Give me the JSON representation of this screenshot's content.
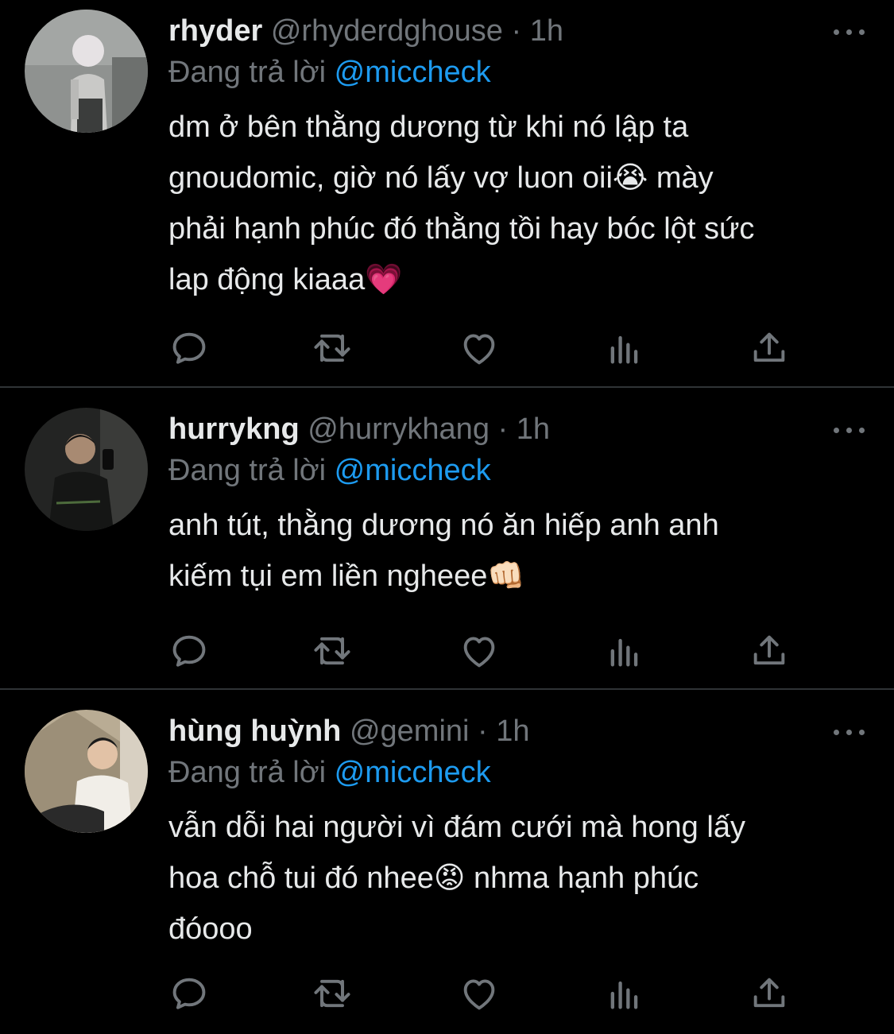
{
  "tweets": [
    {
      "name": "rhyder",
      "handle": "@rhyderdghouse",
      "separator": "·",
      "time": "1h",
      "reply_prefix": "Đang trả lời",
      "reply_to": "@miccheck",
      "lines": [
        "dm ở bên thằng dương từ khi nó lập ta",
        "gnoudomic, giờ nó lấy vợ luon oii😭  mày",
        "phải hạnh phúc đó thằng tồi hay bóc lột sức",
        "lap động kiaaa💗"
      ]
    },
    {
      "name": "hurrykng",
      "handle": "@hurrykhang",
      "separator": "·",
      "time": "1h",
      "reply_prefix": "Đang trả lời",
      "reply_to": "@miccheck",
      "lines": [
        "anh tút, thằng dương nó ăn hiếp anh anh",
        "kiếm tụi em liền ngheee👊🏻"
      ]
    },
    {
      "name": "hùng huỳnh",
      "handle": "@gemini",
      "separator": "·",
      "time": "1h",
      "reply_prefix": "Đang trả lời",
      "reply_to": "@miccheck",
      "lines": [
        "vẫn dỗi hai người vì đám cưới mà hong lấy",
        "hoa chỗ tui đó nhee😡  nhma hạnh phúc",
        "đóooo"
      ]
    }
  ],
  "colors": {
    "background": "#000000",
    "primary_text": "#e7e9ea",
    "secondary_text": "#71767b",
    "link": "#1d9bf0",
    "divider": "#2f3336"
  },
  "icons": [
    "more-icon",
    "reply-icon",
    "retweet-icon",
    "like-icon",
    "views-icon",
    "share-icon"
  ]
}
